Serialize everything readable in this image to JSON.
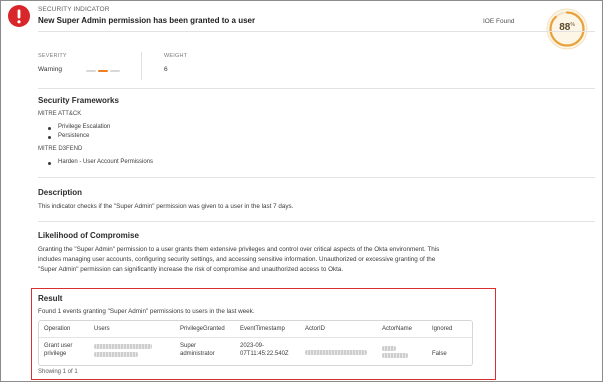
{
  "header": {
    "eyebrow": "SECURITY INDICATOR",
    "title": "New Super Admin permission has been granted to a user",
    "ide_found": "IOE Found",
    "score": "88",
    "score_unit": "%",
    "score_fraction": 0.88,
    "alert_color": "#d8262a",
    "gauge_color": "#e8a23a"
  },
  "meta": {
    "severity_label": "SEVERITY",
    "severity_value": "Warning",
    "weight_label": "WEIGHT",
    "weight_value": "6",
    "severity_accent": "#ef7d22"
  },
  "frameworks": {
    "heading": "Security Frameworks",
    "groups": [
      {
        "name": "MITRE ATT&CK",
        "items": [
          "Privilege Escalation",
          "Persistence"
        ]
      },
      {
        "name": "MITRE D3FEND",
        "items": [
          "Harden - User Account Permissions"
        ]
      }
    ]
  },
  "description": {
    "heading": "Description",
    "text": "This indicator checks if the \"Super Admin\" permission was given to a user in the last 7 days."
  },
  "likelihood": {
    "heading": "Likelihood of Compromise",
    "lines": [
      "Granting the \"Super Admin\" permission to a user grants them extensive privileges and control over critical aspects of the Okta environment. This",
      "includes managing user accounts, configuring security settings, and accessing sensitive information. Unauthorized or excessive granting of the",
      "\"Super Admin\" permission can significantly increase the risk of compromise and unauthorized access to Okta."
    ]
  },
  "result": {
    "heading": "Result",
    "summary": "Found 1 events granting \"Super Admin\" permissions to users in the last week.",
    "columns": [
      "Operation",
      "Users",
      "PrivilegeGranted",
      "EventTimestamp",
      "ActorID",
      "ActorName",
      "Ignored"
    ],
    "row": {
      "operation": [
        "Grant user",
        "privilege"
      ],
      "privilege": [
        "Super",
        "administrator"
      ],
      "timestamp": [
        "2023-09-",
        "07T11:45:22.540Z"
      ],
      "ignored": "False"
    },
    "footer": "Showing 1 of 1",
    "highlight_color": "#d9302f"
  }
}
